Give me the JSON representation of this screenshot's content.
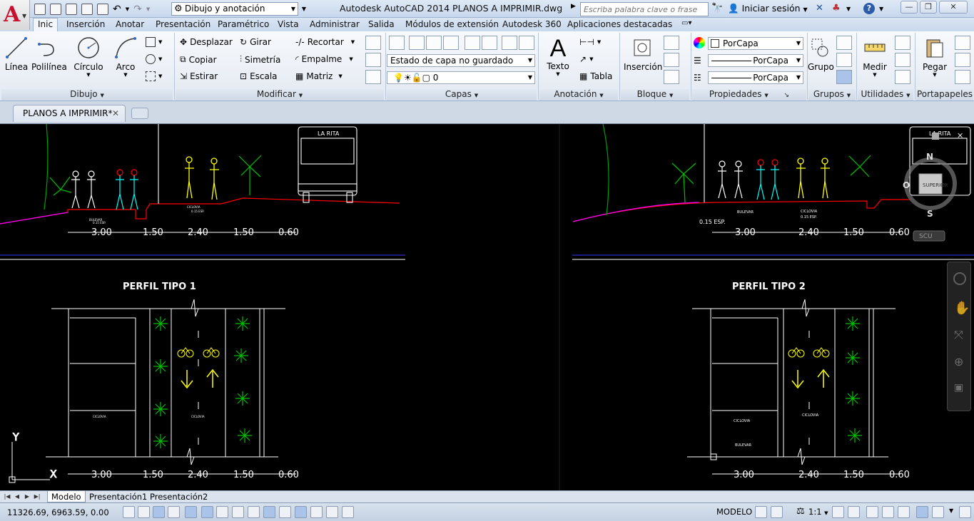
{
  "titlebar": {
    "workspace": "Dibujo y anotación",
    "title": "Autodesk AutoCAD 2014    PLANOS A IMPRIMIR.dwg",
    "search_placeholder": "Escriba palabra clave o frase",
    "signin": "Iniciar sesión"
  },
  "tabs": [
    "Inic",
    "Inserción",
    "Anotar",
    "Presentación",
    "Paramétrico",
    "Vista",
    "Administrar",
    "Salida",
    "Módulos de extensión",
    "Autodesk 360",
    "Aplicaciones destacadas"
  ],
  "ribbon": {
    "dibujo": {
      "label": "Dibujo",
      "linea": "Línea",
      "polilinea": "Polilínea",
      "circulo": "Círculo",
      "arco": "Arco"
    },
    "modificar": {
      "label": "Modificar",
      "desplazar": "Desplazar",
      "girar": "Girar",
      "recortar": "Recortar",
      "copiar": "Copiar",
      "simetria": "Simetría",
      "empalme": "Empalme",
      "estirar": "Estirar",
      "escala": "Escala",
      "matriz": "Matriz"
    },
    "capas": {
      "label": "Capas",
      "state": "Estado de capa no guardado",
      "current": "0"
    },
    "anotacion": {
      "label": "Anotación",
      "texto": "Texto",
      "tabla": "Tabla"
    },
    "bloque": {
      "label": "Bloque",
      "insercion": "Inserción"
    },
    "propiedades": {
      "label": "Propiedades",
      "color": "PorCapa",
      "linetype": "PorCapa",
      "lineweight": "PorCapa"
    },
    "grupos": {
      "label": "Grupos",
      "grupo": "Grupo"
    },
    "utilidades": {
      "label": "Utilidades",
      "medir": "Medir"
    },
    "portapapeles": {
      "label": "Portapapeles",
      "pegar": "Pegar"
    }
  },
  "document": {
    "tab": "PLANOS A IMPRIMIR*"
  },
  "drawing": {
    "left": {
      "bus_label": "LA RITA",
      "section_dims": [
        "3.00",
        "1.50",
        "2.40",
        "1.50",
        "0.60"
      ],
      "plan_title": "PERFIL TIPO 1",
      "plan_dims": [
        "3.00",
        "1.50",
        "2.40",
        "1.50",
        "0.60"
      ],
      "notes": {
        "bulevar": "BULEVAR",
        "ciclovia": "CICLOVIA",
        "espesor": "0.15 ESP."
      }
    },
    "right": {
      "bus_label": "LA RITA",
      "section_dims": [
        "3.00",
        "2.40",
        "1.50",
        "0.60"
      ],
      "plan_title": "PERFIL TIPO 2",
      "plan_dims": [
        "3.00",
        "2.40",
        "1.50",
        "0.60"
      ],
      "esp_note": "0.15  ESP.",
      "notes": {
        "bulevar": "BULEVAR",
        "ciclovia": "CICLOVIA",
        "espesor": "0.15 ESP."
      }
    },
    "viewcube": {
      "n": "N",
      "s": "S",
      "o": "O",
      "face": "SUPERIOR",
      "scu": "SCU"
    },
    "ucs": {
      "y": "Y",
      "x": "X"
    }
  },
  "layout_tabs": [
    "Modelo",
    "Presentación1",
    "Presentación2"
  ],
  "statusbar": {
    "coords": "11326.69, 6963.59, 0.00",
    "model": "MODELO",
    "scale": "1:1"
  },
  "colors": {
    "accent_red": "#c8102e",
    "ribbon_bg": "#e3e9f2",
    "cad_red": "#ff0000",
    "cad_yellow": "#ffff00",
    "cad_green": "#00c000",
    "cad_magenta": "#ff00ff",
    "cad_blue": "#3333ff"
  }
}
